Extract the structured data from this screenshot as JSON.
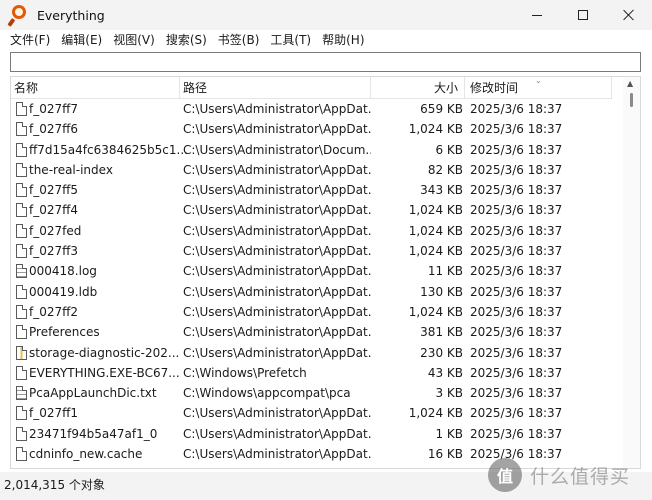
{
  "window": {
    "title": "Everything",
    "minimize_icon": "minimize-icon",
    "maximize_icon": "maximize-icon",
    "close_icon": "close-icon"
  },
  "menu": {
    "items": [
      "文件(F)",
      "编辑(E)",
      "视图(V)",
      "搜索(S)",
      "书签(B)",
      "工具(T)",
      "帮助(H)"
    ]
  },
  "search": {
    "value": ""
  },
  "columns": {
    "name": "名称",
    "path": "路径",
    "size": "大小",
    "modified": "修改时间"
  },
  "files": [
    {
      "icon": "file",
      "name": "f_027ff7",
      "path": "C:\\Users\\Administrator\\AppDat...",
      "size": "659 KB",
      "modified": "2025/3/6 18:37"
    },
    {
      "icon": "file",
      "name": "f_027ff6",
      "path": "C:\\Users\\Administrator\\AppDat...",
      "size": "1,024 KB",
      "modified": "2025/3/6 18:37"
    },
    {
      "icon": "file",
      "name": "ff7d15a4fc6384625b5c1...",
      "path": "C:\\Users\\Administrator\\Docum...",
      "size": "6 KB",
      "modified": "2025/3/6 18:37"
    },
    {
      "icon": "file",
      "name": "the-real-index",
      "path": "C:\\Users\\Administrator\\AppDat...",
      "size": "82 KB",
      "modified": "2025/3/6 18:37"
    },
    {
      "icon": "file",
      "name": "f_027ff5",
      "path": "C:\\Users\\Administrator\\AppDat...",
      "size": "343 KB",
      "modified": "2025/3/6 18:37"
    },
    {
      "icon": "file",
      "name": "f_027ff4",
      "path": "C:\\Users\\Administrator\\AppDat...",
      "size": "1,024 KB",
      "modified": "2025/3/6 18:37"
    },
    {
      "icon": "file",
      "name": "f_027fed",
      "path": "C:\\Users\\Administrator\\AppDat...",
      "size": "1,024 KB",
      "modified": "2025/3/6 18:37"
    },
    {
      "icon": "file",
      "name": "f_027ff3",
      "path": "C:\\Users\\Administrator\\AppDat...",
      "size": "1,024 KB",
      "modified": "2025/3/6 18:37"
    },
    {
      "icon": "txt",
      "name": "000418.log",
      "path": "C:\\Users\\Administrator\\AppDat...",
      "size": "11 KB",
      "modified": "2025/3/6 18:37"
    },
    {
      "icon": "file",
      "name": "000419.ldb",
      "path": "C:\\Users\\Administrator\\AppDat...",
      "size": "130 KB",
      "modified": "2025/3/6 18:37"
    },
    {
      "icon": "file",
      "name": "f_027ff2",
      "path": "C:\\Users\\Administrator\\AppDat...",
      "size": "1,024 KB",
      "modified": "2025/3/6 18:37"
    },
    {
      "icon": "file",
      "name": "Preferences",
      "path": "C:\\Users\\Administrator\\AppDat...",
      "size": "381 KB",
      "modified": "2025/3/6 18:37"
    },
    {
      "icon": "zip",
      "name": "storage-diagnostic-202...",
      "path": "C:\\Users\\Administrator\\AppDat...",
      "size": "230 KB",
      "modified": "2025/3/6 18:37"
    },
    {
      "icon": "file",
      "name": "EVERYTHING.EXE-BC67...",
      "path": "C:\\Windows\\Prefetch",
      "size": "43 KB",
      "modified": "2025/3/6 18:37"
    },
    {
      "icon": "txt",
      "name": "PcaAppLaunchDic.txt",
      "path": "C:\\Windows\\appcompat\\pca",
      "size": "3 KB",
      "modified": "2025/3/6 18:37"
    },
    {
      "icon": "file",
      "name": "f_027ff1",
      "path": "C:\\Users\\Administrator\\AppDat...",
      "size": "1,024 KB",
      "modified": "2025/3/6 18:37"
    },
    {
      "icon": "file",
      "name": "23471f94b5a47af1_0",
      "path": "C:\\Users\\Administrator\\AppDat...",
      "size": "1 KB",
      "modified": "2025/3/6 18:37"
    },
    {
      "icon": "file",
      "name": "cdninfo_new.cache",
      "path": "C:\\Users\\Administrator\\AppDat...",
      "size": "16 KB",
      "modified": "2025/3/6 18:37"
    }
  ],
  "status": {
    "text": "2,014,315 个对象"
  },
  "watermark": {
    "badge": "值",
    "text": "什么值得买"
  },
  "colors": {
    "app_icon": "#e35a00",
    "chrome": "#f3f3f3"
  }
}
